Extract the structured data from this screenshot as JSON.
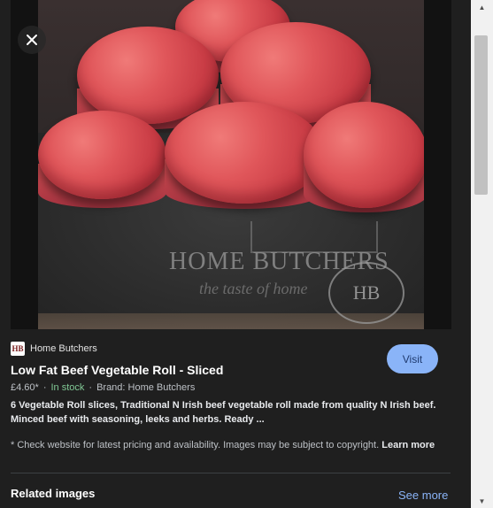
{
  "image": {
    "alt": "Low Fat Beef Vegetable Roll - Sliced",
    "watermark_text": "HOME BUTCHERS",
    "watermark_tagline": "the taste of home",
    "seal_text": "HB"
  },
  "source": {
    "favicon_text": "HB",
    "name": "Home Butchers"
  },
  "product": {
    "title": "Low Fat Beef Vegetable Roll - Sliced",
    "price": "£4.60*",
    "stock": "In stock",
    "brand": "Brand: Home Butchers",
    "description": "6 Vegetable Roll slices, Traditional N Irish beef vegetable roll made from quality N Irish beef. Minced beef with seasoning, leeks and herbs. Ready ..."
  },
  "actions": {
    "visit_label": "Visit",
    "close_icon": "close-icon"
  },
  "disclaimer": {
    "text": "* Check website for latest pricing and availability. Images may be subject to copyright.",
    "learn_more": "Learn more"
  },
  "related": {
    "heading": "Related images",
    "see_more": "See more"
  },
  "colors": {
    "panel_bg": "#1f1f1f",
    "accent": "#8ab4f8",
    "stock_green": "#81c995"
  }
}
